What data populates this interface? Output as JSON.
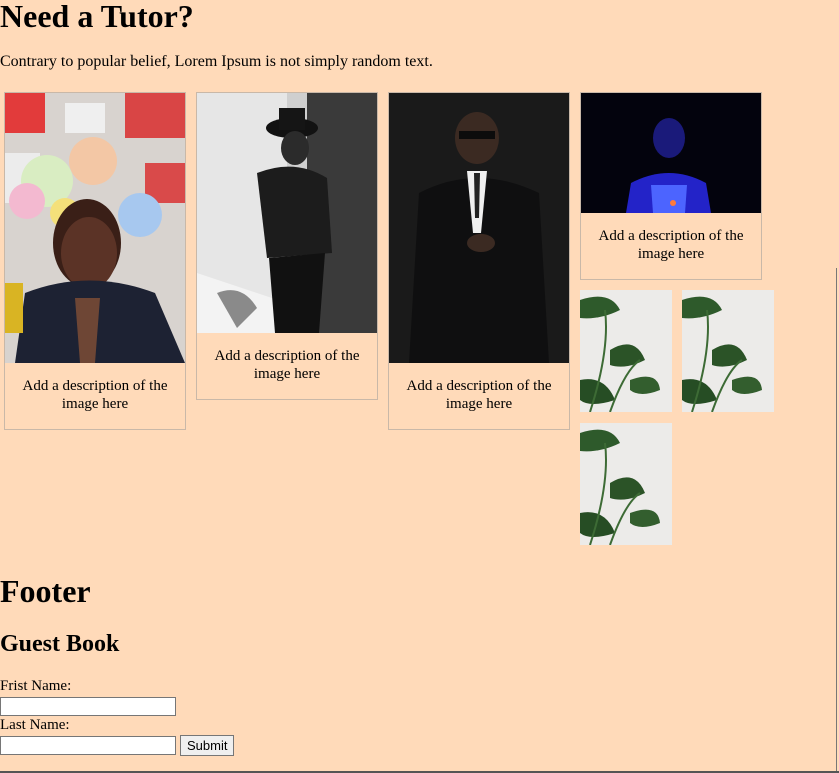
{
  "header": {
    "title": "Need a Tutor?"
  },
  "intro": {
    "text": "Contrary to popular belief, Lorem Ipsum is not simply random text."
  },
  "gallery": {
    "cards": [
      {
        "description": "Add a description of the image here"
      },
      {
        "description": "Add a description of the image here"
      },
      {
        "description": "Add a description of the image here"
      },
      {
        "description": "Add a description of the image here"
      }
    ]
  },
  "footer": {
    "title": "Footer",
    "guestbook": {
      "title": "Guest Book",
      "first_name_label": "Frist Name:",
      "last_name_label": "Last Name:",
      "first_name_value": "",
      "last_name_value": "",
      "submit_label": "Submit"
    }
  },
  "colors": {
    "page_background": "#ffdab9",
    "card_border": "#c9b8a8"
  },
  "icons": [
    "plant-image",
    "portrait-image"
  ]
}
